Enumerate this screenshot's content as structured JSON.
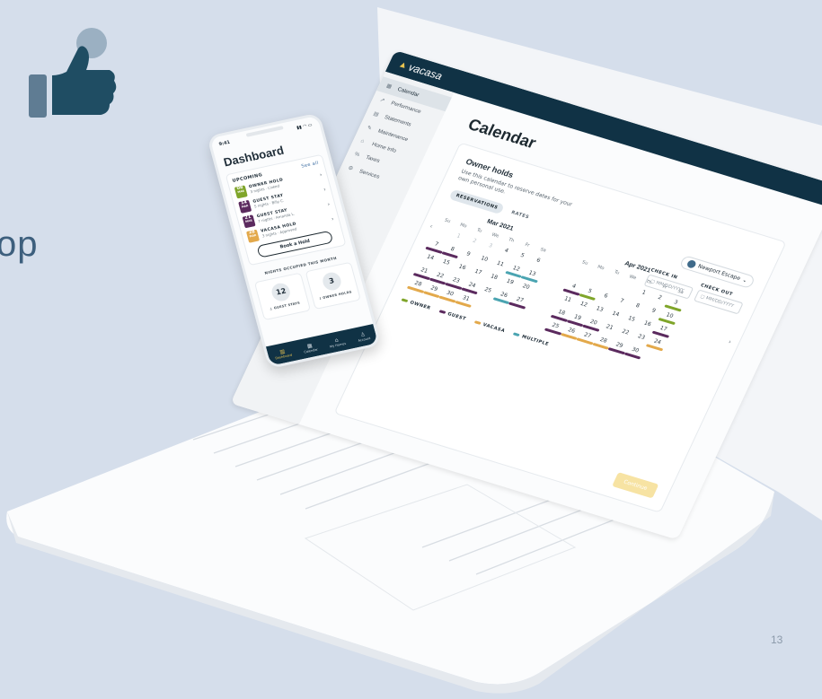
{
  "slide": {
    "fragment_text": "op",
    "page_number": "13"
  },
  "colors": {
    "owner": "#7fa52a",
    "guest": "#5b2a5e",
    "vacasa": "#e3a94b",
    "multiple": "#4aa4b1",
    "navy": "#103245"
  },
  "laptop": {
    "brand": "vacasa",
    "sidebar": [
      {
        "icon": "calendar-icon",
        "label": "Calendar",
        "active": true
      },
      {
        "icon": "chart-icon",
        "label": "Performance"
      },
      {
        "icon": "statement-icon",
        "label": "Statements"
      },
      {
        "icon": "wrench-icon",
        "label": "Maintenance"
      },
      {
        "icon": "home-icon",
        "label": "Home Info"
      },
      {
        "icon": "percent-icon",
        "label": "Taxes"
      },
      {
        "icon": "gear-icon",
        "label": "Services"
      }
    ],
    "page_title": "Calendar",
    "card": {
      "title": "Owner holds",
      "description": "Use this calendar to reserve dates for your own personal use.",
      "tabs": [
        "RESERVATIONS",
        "RATES"
      ],
      "property": "Newport Escape",
      "check_in": {
        "label": "CHECK IN",
        "placeholder": "MM/DD/YYYY"
      },
      "check_out": {
        "label": "CHECK OUT",
        "placeholder": "MM/DD/YYYY"
      },
      "dow": [
        "Su",
        "Mo",
        "Tu",
        "We",
        "Th",
        "Fr",
        "Sa"
      ],
      "months": [
        {
          "title": "Mar 2021",
          "offset": 1,
          "days": 31,
          "muted": [
            1,
            2,
            3
          ],
          "bars": {
            "7": "guest",
            "8": "guest",
            "12": "multiple",
            "13": "multiple",
            "21": "guest",
            "22": "guest",
            "23": "guest",
            "24": "guest",
            "26": "multiple",
            "27": "guest",
            "28": "vacasa",
            "29": "vacasa",
            "30": "vacasa",
            "31": "vacasa"
          }
        },
        {
          "title": "Apr 2021",
          "offset": 4,
          "days": 30,
          "muted": [],
          "bars": {
            "3": "owner",
            "4": "guest",
            "5": "owner",
            "10": "owner",
            "17": "guest",
            "18": "guest",
            "19": "guest",
            "20": "guest",
            "24": "vacasa",
            "25": "guest",
            "26": "vacasa",
            "27": "vacasa",
            "28": "vacasa",
            "29": "guest",
            "30": "guest"
          }
        }
      ],
      "legend": [
        {
          "key": "owner",
          "label": "OWNER"
        },
        {
          "key": "guest",
          "label": "GUEST"
        },
        {
          "key": "vacasa",
          "label": "VACASA"
        },
        {
          "key": "multiple",
          "label": "MULTIPLE"
        }
      ],
      "continue": "Continue"
    }
  },
  "phone": {
    "time": "9:41",
    "title": "Dashboard",
    "upcoming_label": "UPCOMING",
    "see_all": "See all",
    "items": [
      {
        "day": "08",
        "mon": "MAR",
        "color": "owner",
        "title": "OWNER HOLD",
        "sub": "3 nights · Linked"
      },
      {
        "day": "14",
        "mon": "MAR",
        "color": "guest",
        "title": "GUEST STAY",
        "sub": "5 nights · Billy C."
      },
      {
        "day": "21",
        "mon": "MAR",
        "color": "guest",
        "title": "GUEST STAY",
        "sub": "7 nights · Amanda L."
      },
      {
        "day": "28",
        "mon": "MAR",
        "color": "vacasa",
        "title": "VACASA HOLD",
        "sub": "3 nights · Approved"
      }
    ],
    "book": "Book a Hold",
    "nights_label": "NIGHTS OCCUPIED THIS MONTH",
    "stats": [
      {
        "value": "12",
        "label": "GUEST STAYS"
      },
      {
        "value": "3",
        "label": "OWNER HOLDS"
      }
    ],
    "tabs": [
      {
        "icon": "dashboard-icon",
        "label": "Dashboard",
        "active": true
      },
      {
        "icon": "calendar-icon",
        "label": "Calendar"
      },
      {
        "icon": "home-icon",
        "label": "My Homes"
      },
      {
        "icon": "account-icon",
        "label": "Account"
      }
    ]
  }
}
